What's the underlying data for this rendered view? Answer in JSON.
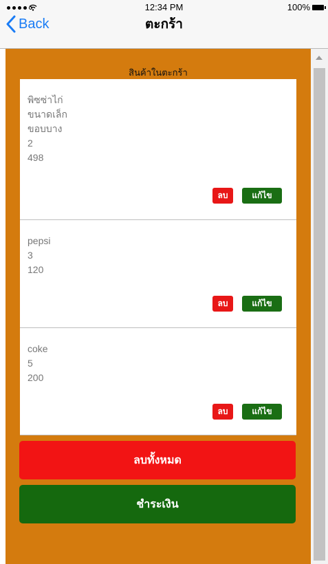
{
  "status_bar": {
    "time": "12:34 PM",
    "battery": "100%"
  },
  "nav": {
    "back_label": "Back",
    "title": "ตะกร้า"
  },
  "cart": {
    "heading": "สินค้าในตะกร้า",
    "items": [
      {
        "lines": [
          "พิซซ่าไก่",
          "ขนาดเล็ก",
          "ขอบบาง",
          "2",
          "498"
        ],
        "delete_label": "ลบ",
        "edit_label": "แก้ไข"
      },
      {
        "lines": [
          "pepsi",
          "3",
          "120"
        ],
        "delete_label": "ลบ",
        "edit_label": "แก้ไข"
      },
      {
        "lines": [
          "coke",
          "5",
          "200"
        ],
        "delete_label": "ลบ",
        "edit_label": "แก้ไข"
      }
    ],
    "clear_all_label": "ลบทั้งหมด",
    "checkout_label": "ชำระเงิน"
  },
  "colors": {
    "background": "#d47b0e",
    "danger": "#f21414",
    "success": "#15690e",
    "link": "#1a7cf5"
  }
}
